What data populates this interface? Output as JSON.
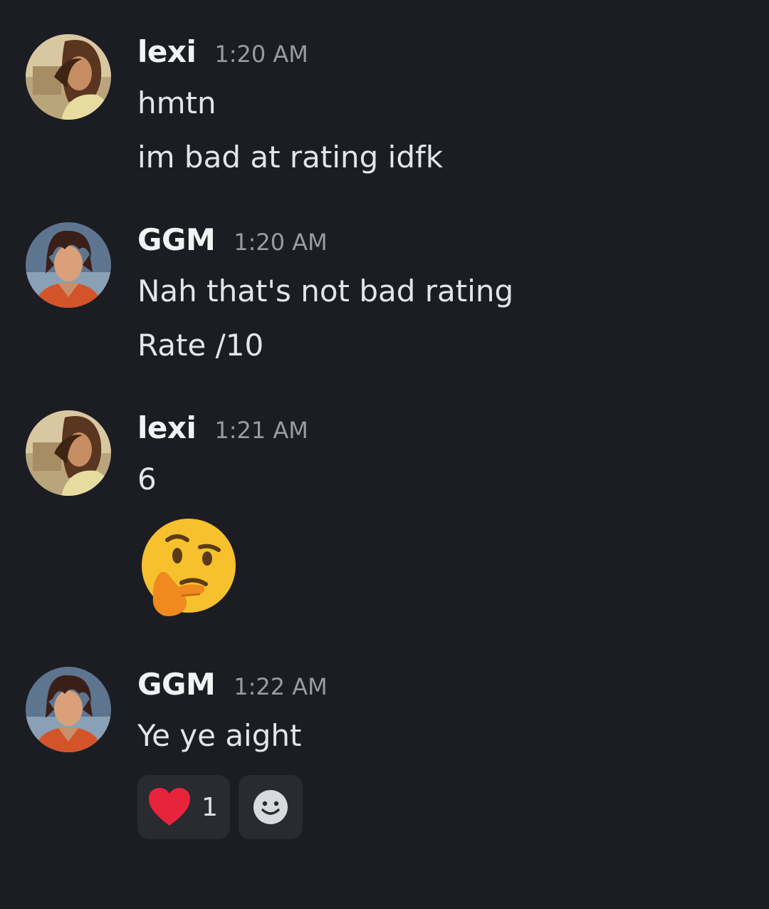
{
  "messages": [
    {
      "author": "lexi",
      "time": "1:20 AM",
      "avatar": "lexi-avatar",
      "lines": [
        "hmtn",
        "im bad at rating idfk"
      ]
    },
    {
      "author": "GGM",
      "time": "1:20 AM",
      "avatar": "ggm-avatar",
      "lines": [
        "Nah that's not bad rating",
        "Rate /10"
      ]
    },
    {
      "author": "lexi",
      "time": "1:21 AM",
      "avatar": "lexi-avatar",
      "lines": [
        "6"
      ],
      "emoji": "thinking-face"
    },
    {
      "author": "GGM",
      "time": "1:22 AM",
      "avatar": "ggm-avatar",
      "lines": [
        "Ye ye aight"
      ],
      "reactions": [
        {
          "emoji": "red-heart",
          "count": "1"
        }
      ],
      "add_reaction_icon": "add-reaction-icon"
    }
  ],
  "colors": {
    "background": "#1c1d23",
    "reaction_bg": "#2a2b31",
    "heart": "#e8243c"
  }
}
